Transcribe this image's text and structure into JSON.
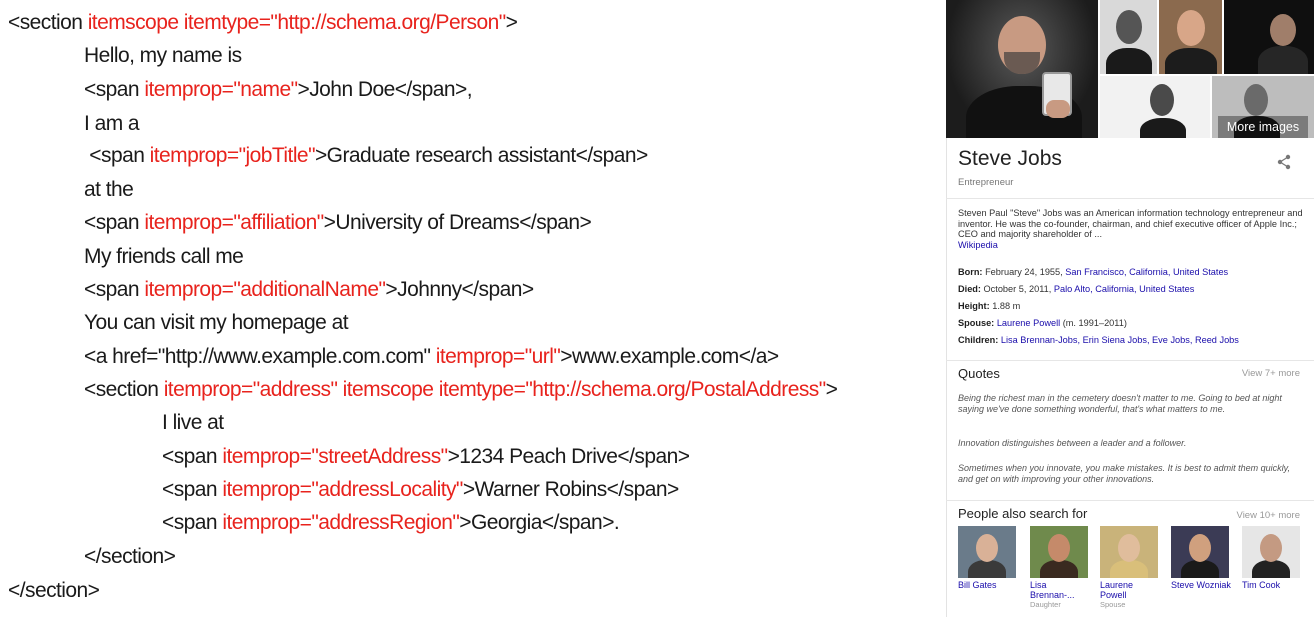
{
  "code": {
    "lines": [
      [
        {
          "t": "<section "
        },
        {
          "t": "itemscope itemtype=\"http://schema.org/Person\"",
          "r": 1
        },
        {
          "t": ">"
        }
      ],
      [
        {
          "t": "Hello, my name is"
        }
      ],
      [
        {
          "t": "<span "
        },
        {
          "t": "itemprop=\"name\"",
          "r": 1
        },
        {
          "t": ">John Doe</span>,"
        }
      ],
      [
        {
          "t": "I am a"
        }
      ],
      [
        {
          "t": " <span "
        },
        {
          "t": "itemprop=\"jobTitle\"",
          "r": 1
        },
        {
          "t": ">Graduate research assistant</span>"
        }
      ],
      [
        {
          "t": "at the"
        }
      ],
      [
        {
          "t": "<span "
        },
        {
          "t": "itemprop=\"affiliation\"",
          "r": 1
        },
        {
          "t": ">University of Dreams</span>"
        }
      ],
      [
        {
          "t": "My friends call me"
        }
      ],
      [
        {
          "t": "<span "
        },
        {
          "t": "itemprop=\"additionalName\"",
          "r": 1
        },
        {
          "t": ">Johnny</span>"
        }
      ],
      [
        {
          "t": "You can visit my homepage at"
        }
      ],
      [
        {
          "t": "<a href=\"http://www.example.com.com\" "
        },
        {
          "t": "itemprop=\"url\"",
          "r": 1
        },
        {
          "t": ">www.example.com</a>"
        }
      ],
      [
        {
          "t": "<section "
        },
        {
          "t": "itemprop=\"address\" itemscope itemtype=\"http://schema.org/PostalAddress\"",
          "r": 1
        },
        {
          "t": ">"
        }
      ],
      [
        {
          "t": "I live at"
        }
      ],
      [
        {
          "t": "<span "
        },
        {
          "t": "itemprop=\"streetAddress\"",
          "r": 1
        },
        {
          "t": ">1234 Peach Drive</span>"
        }
      ],
      [
        {
          "t": "<span "
        },
        {
          "t": "itemprop=\"addressLocality\"",
          "r": 1
        },
        {
          "t": ">Warner Robins</span>"
        }
      ],
      [
        {
          "t": "<span "
        },
        {
          "t": "itemprop=\"addressRegion\"",
          "r": 1
        },
        {
          "t": ">Georgia</span>."
        }
      ],
      [
        {
          "t": "</section>"
        }
      ],
      [
        {
          "t": "</section>"
        }
      ]
    ],
    "colors": {
      "text": "#1a1a1a",
      "attribute": "#e8231d"
    }
  },
  "panel": {
    "more_images": "More images",
    "title": "Steve Jobs",
    "subtitle": "Entrepreneur",
    "description": "Steven Paul \"Steve\" Jobs was an American information technology entrepreneur and inventor. He was the co-founder, chairman, and chief executive officer of Apple Inc.; CEO and majority shareholder of ...",
    "description_link": "Wikipedia",
    "facts": [
      {
        "label": "Born:",
        "text": "February 24, 1955, ",
        "link": "San Francisco, California, United States"
      },
      {
        "label": "Died:",
        "text": "October 5, 2011, ",
        "link": "Palo Alto, California, United States"
      },
      {
        "label": "Height:",
        "text": "1.88 m",
        "link": ""
      },
      {
        "label": "Spouse:",
        "text": " (m. 1991–2011)",
        "link": "Laurene Powell",
        "link_first": true
      },
      {
        "label": "Children:",
        "text": "",
        "link": "Lisa Brennan-Jobs, Erin Siena Jobs, Eve Jobs, Reed Jobs"
      }
    ],
    "quotes_title": "Quotes",
    "quotes_more": "View 7+ more",
    "quotes": [
      "Being the richest man in the cemetery doesn't matter to me. Going to bed at night saying we've done something wonderful, that's what matters to me.",
      "Innovation distinguishes between a leader and a follower.",
      "Sometimes when you innovate, you make mistakes. It is best to admit them quickly, and get on with improving your other innovations."
    ],
    "people_title": "People also search for",
    "people_more": "View 10+ more",
    "people": [
      {
        "name": "Bill Gates",
        "relation": ""
      },
      {
        "name": "Lisa Brennan-...",
        "relation": "Daughter"
      },
      {
        "name": "Laurene Powell",
        "relation": "Spouse"
      },
      {
        "name": "Steve Wozniak",
        "relation": ""
      },
      {
        "name": "Tim Cook",
        "relation": ""
      }
    ],
    "colors": {
      "link": "#1a0dab",
      "muted": "#999999"
    }
  }
}
